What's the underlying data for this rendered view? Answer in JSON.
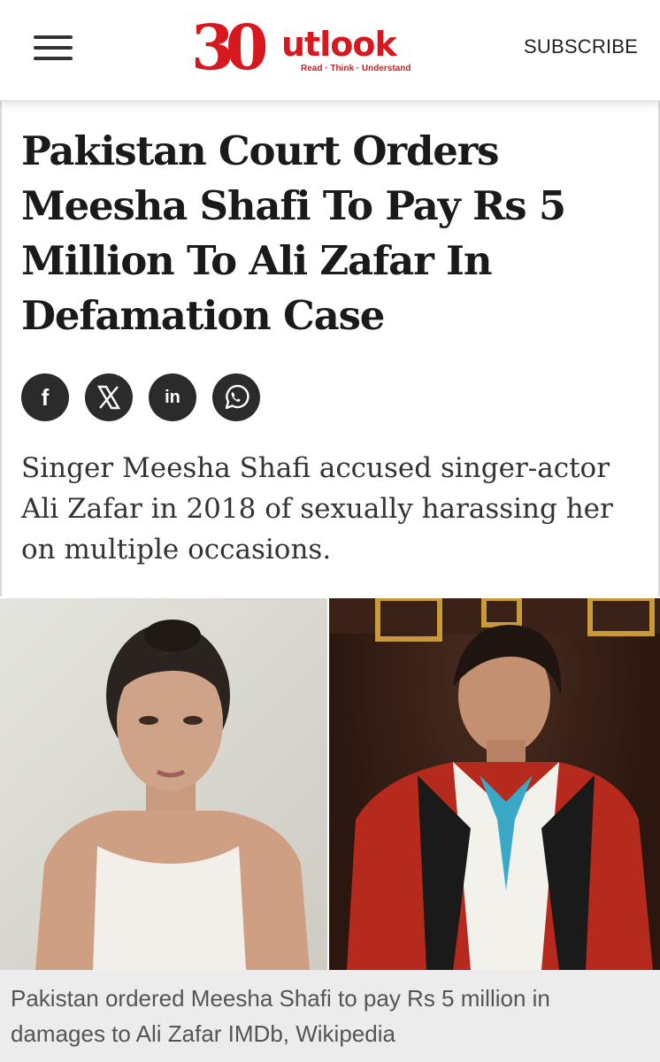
{
  "header": {
    "logo": {
      "number": "30",
      "word": "utlook",
      "tagline": "Read · Think · Understand"
    },
    "subscribe_label": "SUBSCRIBE",
    "menu_icon": "hamburger-menu-icon"
  },
  "article": {
    "headline": "Pakistan Court Orders Meesha Shafi To Pay Rs 5 Million To Ali Zafar In Defamation Case",
    "share": [
      {
        "name": "facebook",
        "icon": "facebook-icon",
        "glyph": "f"
      },
      {
        "name": "x",
        "icon": "x-icon",
        "glyph": "X"
      },
      {
        "name": "linkedin",
        "icon": "linkedin-icon",
        "glyph": "in"
      },
      {
        "name": "whatsapp",
        "icon": "whatsapp-icon",
        "glyph": ""
      }
    ],
    "summary": "Singer Meesha Shafi accused singer-actor Ali Zafar in 2018 of sexually harassing her on multiple occasions.",
    "image_caption": "Pakistan ordered Meesha Shafi to pay Rs 5 million in damages to Ali Zafar IMDb, Wikipedia"
  },
  "colors": {
    "brand": "#d7191f",
    "text": "#1a1a1a",
    "icon_bg": "#2b2b2b",
    "caption_bg": "#ececec"
  }
}
